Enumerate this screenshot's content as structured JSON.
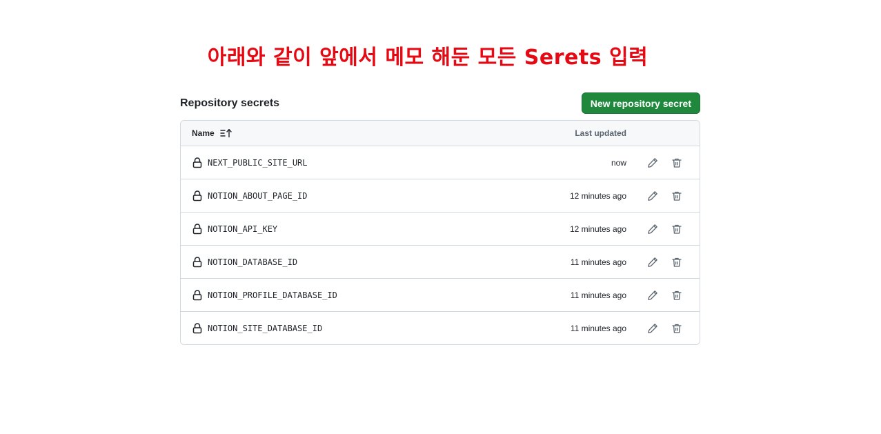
{
  "annotation": {
    "text": "아래와 같이 앞에서 메모 해둔 모든 Serets 입력",
    "color": "#e50914"
  },
  "section": {
    "title": "Repository secrets",
    "new_button_label": "New repository secret",
    "button_color": "#1f883d"
  },
  "table": {
    "header_name": "Name",
    "header_updated": "Last updated",
    "sort_icon": "sort-ascending-icon",
    "rows": [
      {
        "name": "NEXT_PUBLIC_SITE_URL",
        "updated": "now"
      },
      {
        "name": "NOTION_ABOUT_PAGE_ID",
        "updated": "12 minutes ago"
      },
      {
        "name": "NOTION_API_KEY",
        "updated": "12 minutes ago"
      },
      {
        "name": "NOTION_DATABASE_ID",
        "updated": "11 minutes ago"
      },
      {
        "name": "NOTION_PROFILE_DATABASE_ID",
        "updated": "11 minutes ago"
      },
      {
        "name": "NOTION_SITE_DATABASE_ID",
        "updated": "11 minutes ago"
      }
    ],
    "row_icon": "lock-icon",
    "edit_icon": "pencil-icon",
    "delete_icon": "trash-icon"
  }
}
